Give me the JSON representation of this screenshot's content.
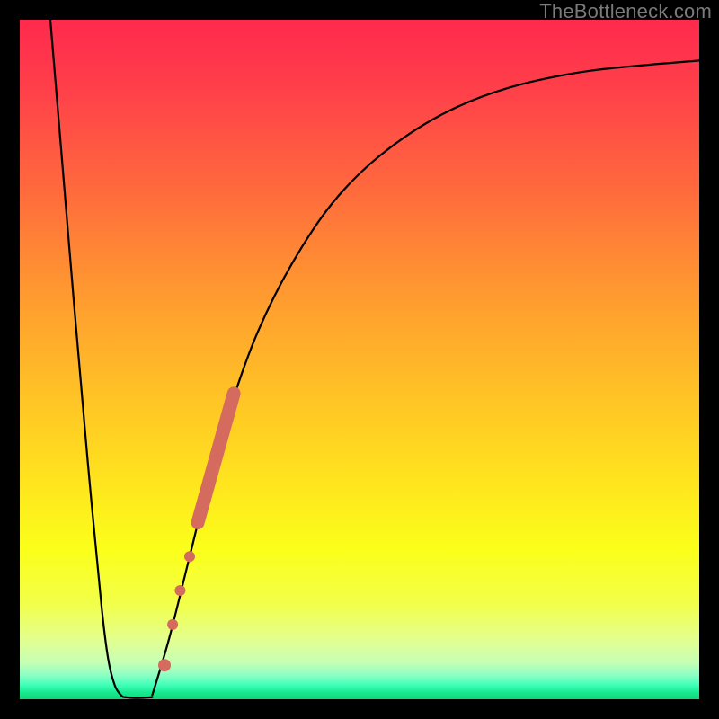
{
  "watermark": "TheBottleneck.com",
  "chart_data": {
    "type": "line",
    "title": "",
    "xlabel": "",
    "ylabel": "",
    "xlim": [
      0,
      100
    ],
    "ylim": [
      0,
      100
    ],
    "grid": false,
    "legend": false,
    "series": [
      {
        "name": "left-branch",
        "x": [
          4.5,
          6,
          8,
          10,
          12,
          13,
          14,
          15,
          15.5
        ],
        "y": [
          100,
          82,
          58,
          35,
          14,
          6,
          2,
          0.5,
          0.3
        ]
      },
      {
        "name": "flat-valley",
        "x": [
          15.5,
          16.5,
          18,
          19.5
        ],
        "y": [
          0.3,
          0.2,
          0.2,
          0.3
        ]
      },
      {
        "name": "right-branch",
        "x": [
          19.5,
          22,
          25,
          28,
          31,
          35,
          40,
          46,
          53,
          62,
          72,
          84,
          100
        ],
        "y": [
          0.6,
          9,
          21,
          33,
          43,
          54,
          64,
          73,
          80,
          86,
          90,
          92.5,
          94
        ]
      }
    ],
    "markers": {
      "name": "highlighted-points",
      "color": "#d56a5e",
      "points": [
        {
          "x": 21.3,
          "y": 5,
          "r": 7
        },
        {
          "x": 22.5,
          "y": 11,
          "r": 6
        },
        {
          "x": 23.6,
          "y": 16,
          "r": 6
        },
        {
          "x": 25.0,
          "y": 21,
          "r": 6
        }
      ],
      "band": {
        "x0": 26.2,
        "y0": 26,
        "x1": 31.5,
        "y1": 45,
        "width": 15
      }
    }
  }
}
